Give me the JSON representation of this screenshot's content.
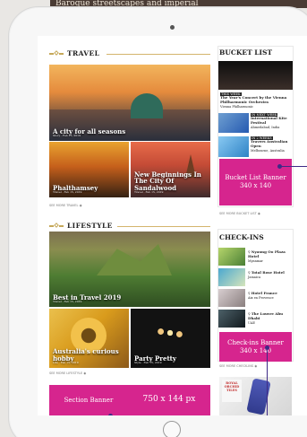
{
  "header_strip": "Baroque streetscapes and imperial",
  "travel": {
    "title": "TRAVEL",
    "feature": "A city for all seasons",
    "feature_meta": "Story · Feb 15, 2019",
    "card1": "Phalthamsey",
    "card1_meta": "Travel · Feb 15, 2019",
    "card2_line1": "New Beginnings In",
    "card2_line2": "The City Of Sandalwood",
    "card2_meta": "Travel · Feb 15, 2019",
    "see_more": "SEE MORE TRAVEL"
  },
  "lifestyle": {
    "title": "LIFESTYLE",
    "feature": "Best in Travel 2019",
    "feature_meta": "Travel · Feb 15, 2019",
    "card1": "Australia's curious hobby",
    "card1_meta": "Life · Feb 15, 2019",
    "card2": "Party Pretty",
    "card2_meta": "Style · Feb 15, 2019",
    "see_more": "SEE MORE LIFESTYLE"
  },
  "bucket": {
    "title": "BUCKET LIST",
    "items": [
      {
        "tag": "THIS WEEK",
        "title": "The Year's Concert by the Vienna Philharmonic Orchestra",
        "meta": "Vienna Philharmonic"
      },
      {
        "tag": "IN NEXT WEEK",
        "title": "International Kite Festival",
        "meta": "Ahmedabad, India"
      },
      {
        "tag": "IN 2 WEEKS",
        "title": "Travers Australian Open",
        "meta": "Melbourne, Australia"
      }
    ],
    "banner_line1": "Bucket List Banner",
    "banner_line2": "340 x 140",
    "see_more": "SEE MORE BUCKET LIST"
  },
  "checkins": {
    "title": "CHECK-INS",
    "items": [
      {
        "title": "Nyaung Oo Plaza Hotel",
        "meta": "Myanmar"
      },
      {
        "title": "Total Rose Hotel",
        "meta": "Jamaica"
      },
      {
        "title": "Hotel France",
        "meta": "Aix en Provence"
      },
      {
        "title": "The Louvre Abu Dhabi",
        "meta": "UAE"
      }
    ],
    "banner_line1": "Check-ins Banner",
    "banner_line2": "340 x 140",
    "see_more": "SEE MORE CHECK-INS"
  },
  "section_banner": {
    "label": "Section Banner",
    "size": "750 x 144 px"
  },
  "promo_badge": "ROYAL ORCHID TILES"
}
